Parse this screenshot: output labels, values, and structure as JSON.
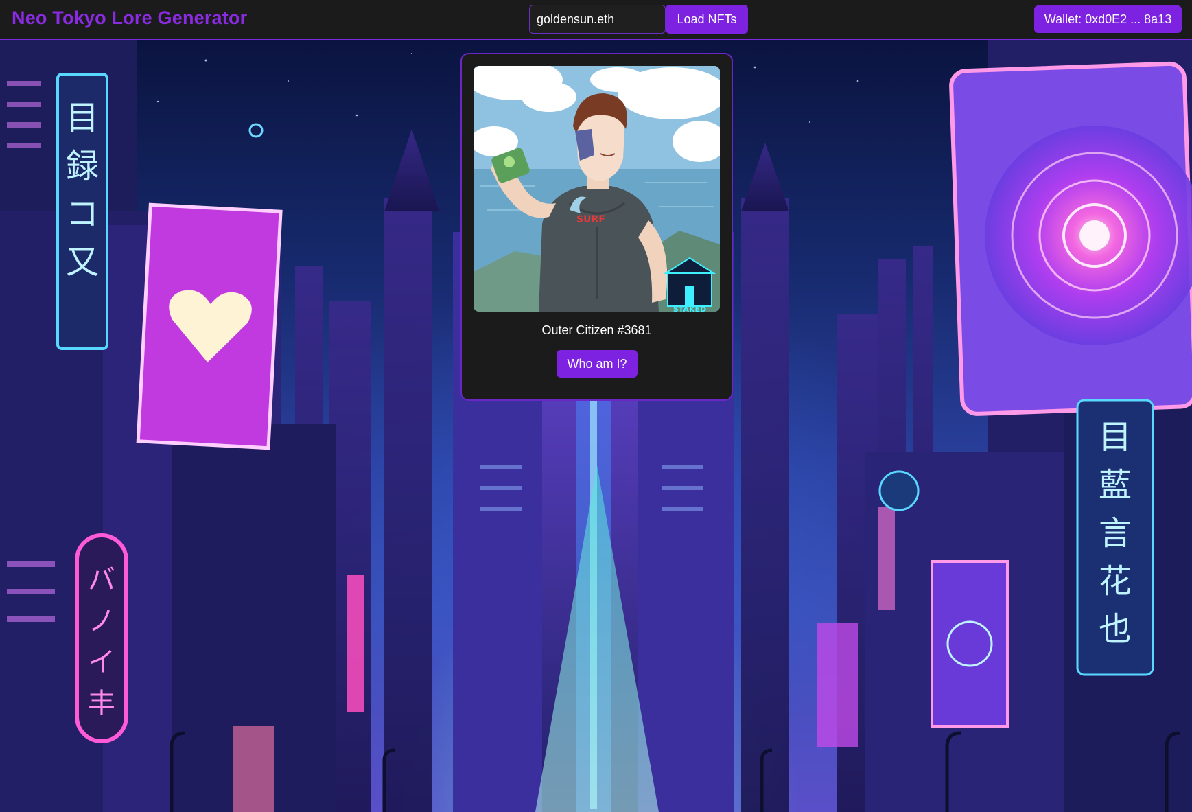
{
  "header": {
    "title": "Neo Tokyo Lore Generator",
    "search_value": "goldensun.eth",
    "load_label": "Load NFTs",
    "wallet_label": "Wallet: 0xd0E2 ... 8a13"
  },
  "nft": {
    "name": "Outer Citizen #3681",
    "action_label": "Who am I?",
    "badge_text": "STAKED",
    "shirt_text": "SURF"
  },
  "background": {
    "description_icon": "cyberpunk-city-background",
    "sign_left": "目録コ又",
    "sign_bottom_left": "バノイ丰",
    "sign_right": "目藍言花也"
  },
  "colors": {
    "accent": "#7e22e2",
    "title": "#8a2be2",
    "header_bg": "#1b1b1b",
    "card_bg": "#1b1b1b"
  }
}
